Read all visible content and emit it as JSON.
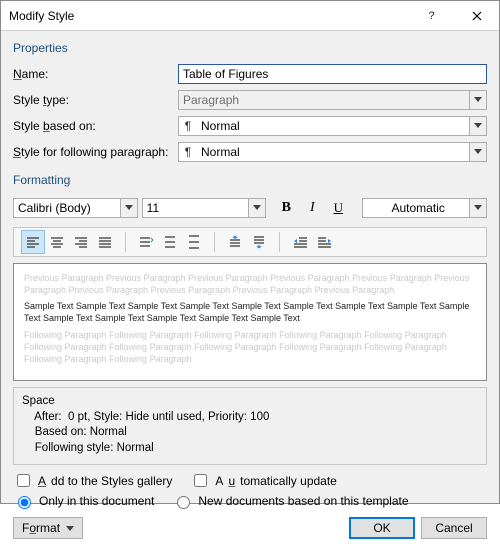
{
  "titlebar": {
    "title": "Modify Style"
  },
  "sections": {
    "properties": "Properties",
    "formatting": "Formatting"
  },
  "properties": {
    "name_label": "Name:",
    "name_value": "Table of Figures",
    "styletype_label": "Style type:",
    "styletype_value": "Paragraph",
    "basedon_label": "Style based on:",
    "basedon_value": "Normal",
    "following_label": "Style for following paragraph:",
    "following_value": "Normal"
  },
  "formatting": {
    "font_name": "Calibri (Body)",
    "font_size": "11",
    "color_label": "Automatic"
  },
  "preview": {
    "ghost_prev": "Previous Paragraph Previous Paragraph Previous Paragraph Previous Paragraph Previous Paragraph Previous Paragraph Previous Paragraph Previous Paragraph Previous Paragraph Previous Paragraph",
    "sample": "Sample Text Sample Text Sample Text Sample Text Sample Text Sample Text Sample Text Sample Text Sample Text Sample Text Sample Text Sample Text Sample Text Sample Text",
    "ghost_next": "Following Paragraph Following Paragraph Following Paragraph Following Paragraph Following Paragraph Following Paragraph Following Paragraph Following Paragraph Following Paragraph Following Paragraph Following Paragraph Following Paragraph"
  },
  "description": {
    "l1": "Space",
    "l2": "    After:  0 pt, Style: Hide until used, Priority: 100",
    "l3": "    Based on: Normal",
    "l4": "    Following style: Normal"
  },
  "options": {
    "add_gallery": "Add to the Styles gallery",
    "auto_update": "Automatically update",
    "only_doc": "Only in this document",
    "new_docs": "New documents based on this template"
  },
  "buttons": {
    "format": "Format",
    "ok": "OK",
    "cancel": "Cancel"
  }
}
